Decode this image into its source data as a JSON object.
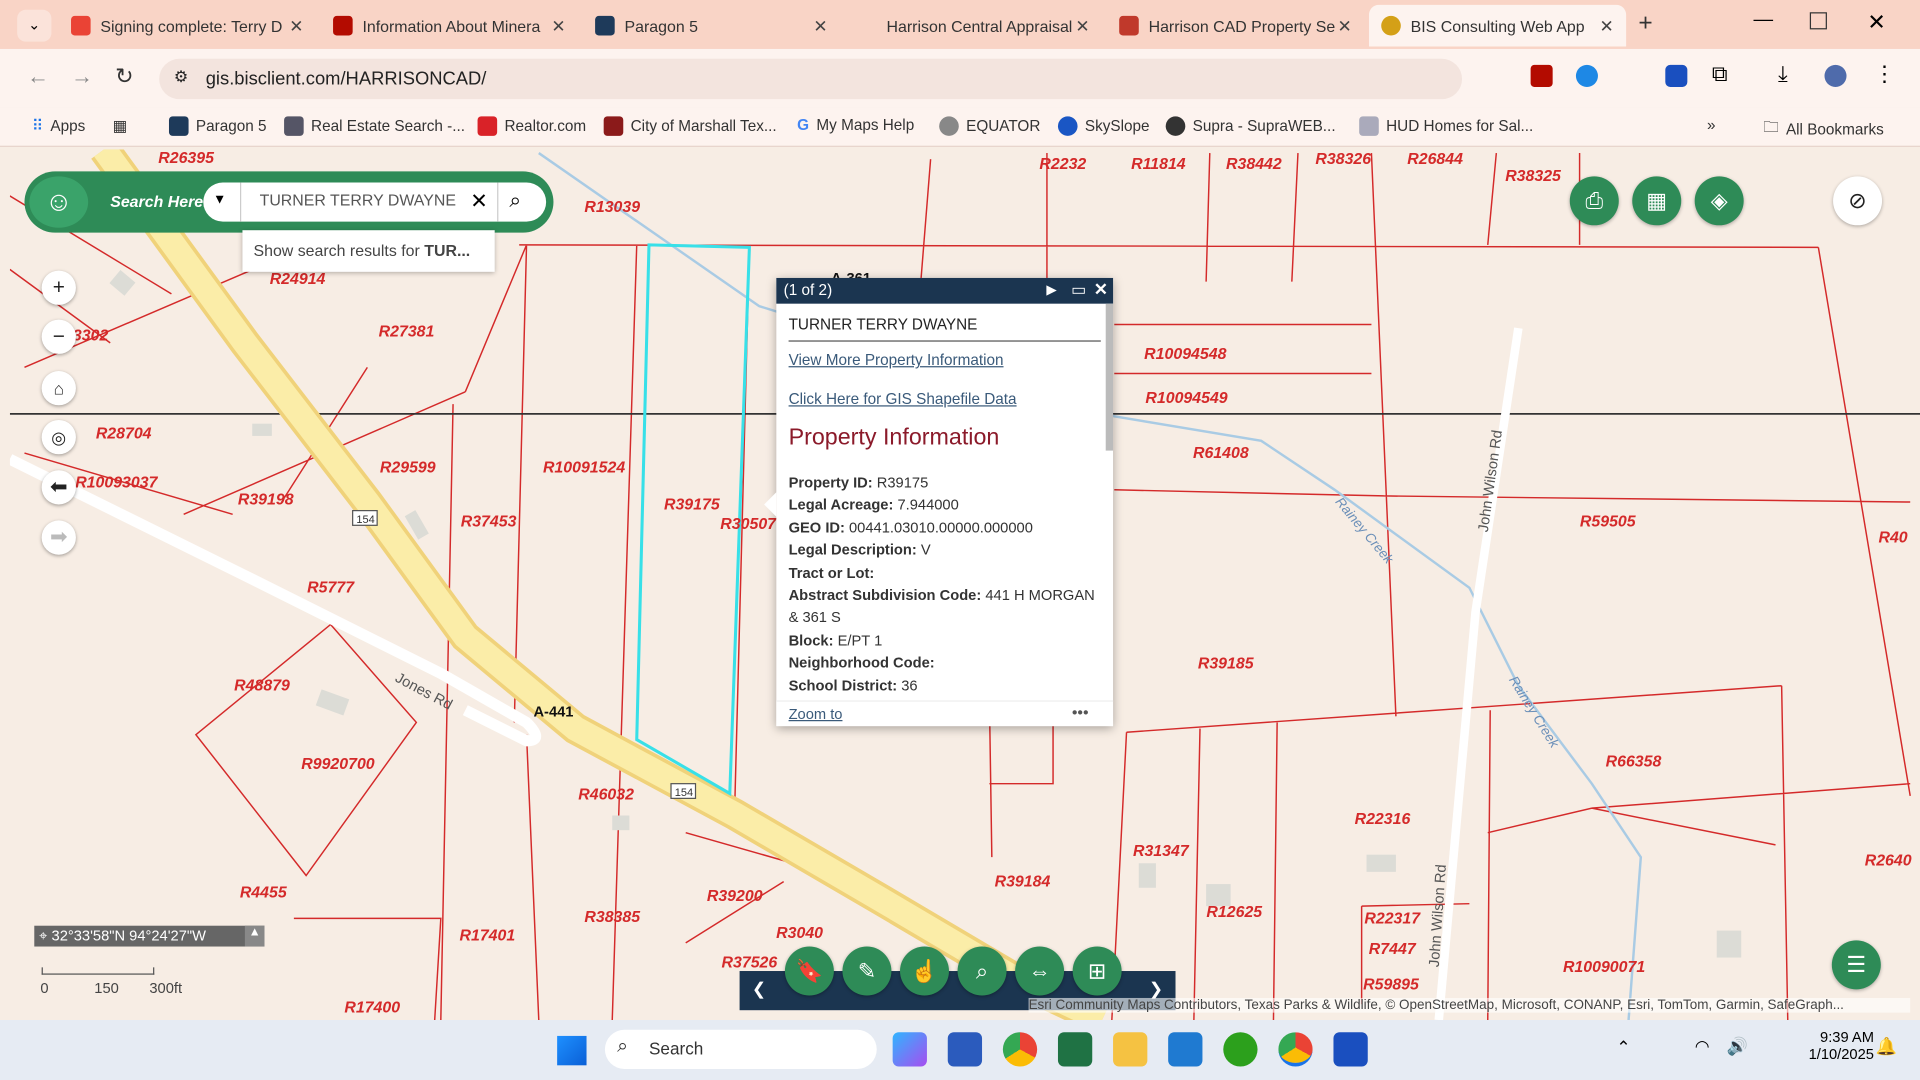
{
  "browser": {
    "tabs": [
      {
        "title": "Signing complete: Terry D",
        "icon": "gmail-icon",
        "color": "#ea4335"
      },
      {
        "title": "Information About Minera",
        "icon": "pdf-icon",
        "color": "#b30b00"
      },
      {
        "title": "Paragon 5",
        "icon": "paragon-icon",
        "color": "#1e3a5a"
      },
      {
        "title": "Harrison Central Appraisal",
        "icon": "blank-icon",
        "color": "#ffffff"
      },
      {
        "title": "Harrison CAD Property Se",
        "icon": "search-page-icon",
        "color": "#c0392b"
      },
      {
        "title": "BIS Consulting Web App",
        "icon": "bis-icon",
        "color": "#d4a017"
      }
    ],
    "url": "gis.bisclient.com/HARRISONCAD/",
    "bookmarks": [
      "Apps",
      "Paragon 5",
      "Real Estate Search -...",
      "Realtor.com",
      "City of Marshall Tex...",
      "My Maps Help",
      "EQUATOR",
      "SkySlope",
      "Supra - SupraWEB...",
      "HUD Homes for Sal..."
    ],
    "all_bookmarks": "All Bookmarks"
  },
  "search": {
    "label": "Search Here:",
    "value": "TURNER TERRY DWAYNE",
    "suggestion_prefix": "Show search results for ",
    "suggestion_term": "TUR..."
  },
  "popup": {
    "counter": "(1 of 2)",
    "owner": "TURNER TERRY DWAYNE",
    "link1": "View More Property Information",
    "link2": "Click Here for GIS Shapefile Data",
    "heading": "Property Information",
    "fields": [
      {
        "label": "Property ID:",
        "value": "R39175"
      },
      {
        "label": "Legal Acreage:",
        "value": "7.944000"
      },
      {
        "label": "GEO ID:",
        "value": "00441.03010.00000.000000"
      },
      {
        "label": "Legal Description:",
        "value": "V"
      },
      {
        "label": "Tract or Lot:",
        "value": ""
      },
      {
        "label": "Abstract Subdivision Code:",
        "value": "441 H MORGAN & 361 S"
      },
      {
        "label": "Block:",
        "value": "E/PT 1"
      },
      {
        "label": "Neighborhood Code:",
        "value": ""
      },
      {
        "label": "School District:",
        "value": "36"
      }
    ],
    "zoom_to": "Zoom to",
    "more": "•••"
  },
  "map": {
    "parcels": [
      "R26395",
      "R13039",
      "R2232",
      "R11814",
      "R38442",
      "R38326",
      "R26844",
      "R38325",
      "R24914",
      "A-361",
      "R27381",
      "3302",
      "R10094548",
      "R10094549",
      "R28704",
      "R29599",
      "R10091524",
      "R61408",
      "R10093037",
      "R39198",
      "R37453",
      "R39175",
      "R30507",
      "R59505",
      "R40",
      "R5777",
      "R39185",
      "R48879",
      "A-441",
      "R9920700",
      "R46032",
      "R66358",
      "R22316",
      "R31347",
      "R2640",
      "R4455",
      "R39184",
      "R39200",
      "R12625",
      "R38385",
      "R3040",
      "R22317",
      "R17401",
      "R7447",
      "R37526",
      "R10090071",
      "R59895",
      "R17400"
    ],
    "roads": {
      "jones": "Jones Rd",
      "john_wilson": "John Wilson Rd",
      "creek": "Rainey Creek",
      "hwy": "154"
    },
    "coords": "32°33'58\"N 94°24'27\"W",
    "scale": [
      "0",
      "150",
      "300ft"
    ],
    "attribution": "Esri Community Maps Contributors, Texas Parks & Wildlife, © OpenStreetMap, Microsoft, CONANP, Esri, TomTom, Garmin, SafeGraph..."
  },
  "taskbar": {
    "search": "Search",
    "time": "9:39 AM",
    "date": "1/10/2025"
  },
  "colors": {
    "accent": "#2e8b57",
    "popup_header": "#1b3550",
    "parcel_line": "#d42a2a",
    "selected": "#38e0e8",
    "toolbar": "#1b3550"
  }
}
